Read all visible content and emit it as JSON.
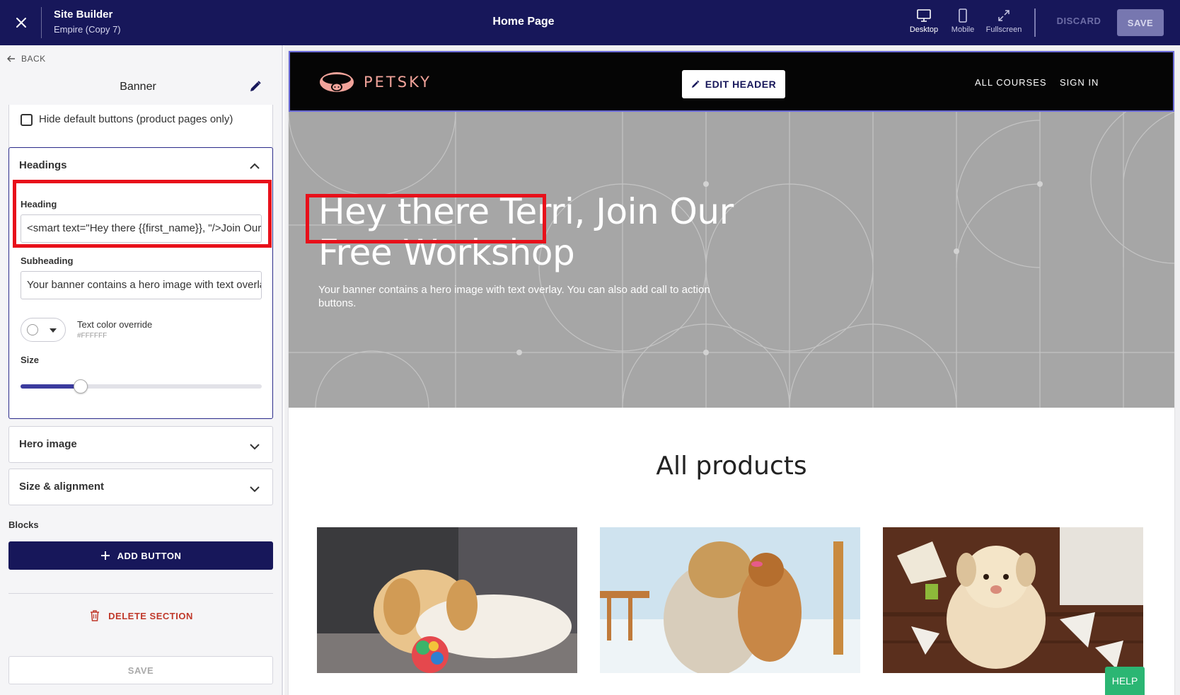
{
  "topbar": {
    "app_title": "Site Builder",
    "site_name": "Empire (Copy 7)",
    "page_name": "Home Page",
    "views": [
      {
        "label": "Desktop",
        "active": true
      },
      {
        "label": "Mobile",
        "active": false
      },
      {
        "label": "Fullscreen",
        "active": false
      }
    ],
    "discard_label": "DISCARD",
    "save_label": "SAVE"
  },
  "sidebar": {
    "back_label": "BACK",
    "section_title": "Banner",
    "hide_default_label": "Hide default buttons (product pages only)",
    "headings": {
      "title": "Headings",
      "heading_label": "Heading",
      "heading_value": "<smart text=\"Hey there {{first_name}}, \"/>Join Our Free Workshop",
      "subheading_label": "Subheading",
      "subheading_value": "Your banner contains a hero image with text overlay. You can also add call to action buttons.",
      "text_color_label": "Text color override",
      "text_color_value": "#FFFFFF",
      "size_label": "Size",
      "size_fraction": 0.25
    },
    "hero_image_label": "Hero image",
    "size_alignment_label": "Size & alignment",
    "blocks_label": "Blocks",
    "add_button_label": "ADD BUTTON",
    "delete_section_label": "DELETE SECTION",
    "save_label": "SAVE"
  },
  "preview": {
    "logo_text": "PETSKY",
    "edit_header_label": "EDIT HEADER",
    "nav": [
      "ALL COURSES",
      "SIGN IN"
    ],
    "hero_title": "Hey there Terri, Join Our Free Workshop",
    "hero_subtitle": "Your banner contains a hero image with text overlay. You can also add call to action buttons.",
    "products_title": "All products",
    "help_label": "HELP"
  },
  "colors": {
    "topbar_bg": "#17175a",
    "accent": "#3b3b9e",
    "highlight": "#e8101a",
    "hero_bg": "#a6a6a6",
    "logo": "#f1a39a",
    "help": "#2bb673"
  }
}
